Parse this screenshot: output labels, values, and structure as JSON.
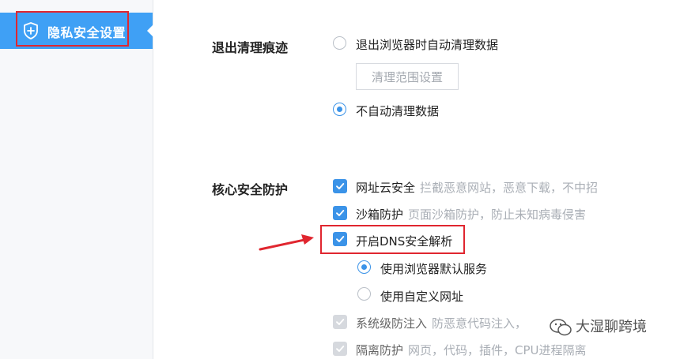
{
  "sidebar": {
    "items": [
      {
        "label": "隐私安全设置",
        "icon": "shield-plus-icon",
        "active": true
      }
    ]
  },
  "sections": {
    "clear_traces": {
      "title": "退出清理痕迹",
      "option_auto_clear": "退出浏览器时自动清理数据",
      "clear_range_button": "清理范围设置",
      "option_no_auto_clear": "不自动清理数据",
      "selected": "option_no_auto_clear"
    },
    "core_security": {
      "title": "核心安全防护",
      "items": [
        {
          "label": "网址云安全",
          "desc": "拦截恶意网站，恶意下载，不中招",
          "checked": true,
          "disabled": false
        },
        {
          "label": "沙箱防护",
          "desc": "页面沙箱防护，防止未知病毒侵害",
          "checked": true,
          "disabled": false
        },
        {
          "label": "开启DNS安全解析",
          "desc": "",
          "checked": true,
          "disabled": false
        }
      ],
      "dns_options": {
        "default_service": "使用浏览器默认服务",
        "custom_address": "使用自定义网址",
        "selected": "default_service"
      },
      "more_items": [
        {
          "label": "系统级防注入",
          "desc": "防恶意代码注入，",
          "checked": true,
          "disabled": true
        },
        {
          "label": "隔离防护",
          "desc": "网页，代码，插件，CPU进程隔离",
          "checked": true,
          "disabled": true
        }
      ]
    }
  },
  "watermark": {
    "text": "大湿聊跨境",
    "icon": "wechat-icon"
  },
  "colors": {
    "accent": "#3b93e8",
    "sidebar_active": "#3fa0f5",
    "highlight": "#e0262f"
  }
}
